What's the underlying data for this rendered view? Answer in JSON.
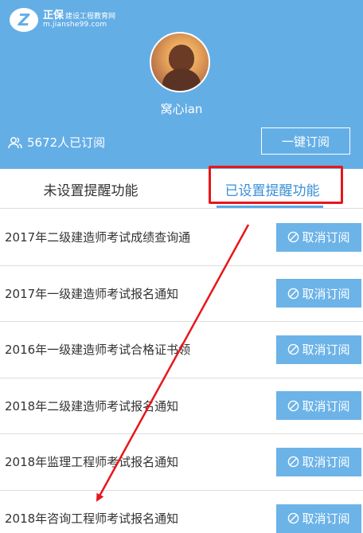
{
  "logo": {
    "mark": "Z",
    "brand": "正保",
    "brand_sub": "建设工程教育网",
    "url": "m.jianshe99.com"
  },
  "profile": {
    "username": "窝心ian",
    "subscribers": "5672人已订阅",
    "subscribe_button": "一键订阅"
  },
  "tabs": [
    {
      "label": "未设置提醒功能",
      "active": false
    },
    {
      "label": "已设置提醒功能",
      "active": true
    }
  ],
  "items": [
    {
      "title": "2017年二级建造师考试成绩查询通",
      "action": "取消订阅"
    },
    {
      "title": "2017年一级建造师考试报名通知",
      "action": "取消订阅"
    },
    {
      "title": "2016年一级建造师考试合格证书领",
      "action": "取消订阅"
    },
    {
      "title": "2018年二级建造师考试报名通知",
      "action": "取消订阅"
    },
    {
      "title": "2018年监理工程师考试报名通知",
      "action": "取消订阅"
    },
    {
      "title": "2018年咨询工程师考试报名通知",
      "action": "取消订阅"
    }
  ],
  "colors": {
    "header_bg": "#64aee6",
    "active_tab": "#3a8fd8",
    "button_bg": "#6cb3e8",
    "annotation": "#e8161a"
  },
  "icons": {
    "subscribers": "users-icon",
    "cancel": "prohibit-icon"
  }
}
